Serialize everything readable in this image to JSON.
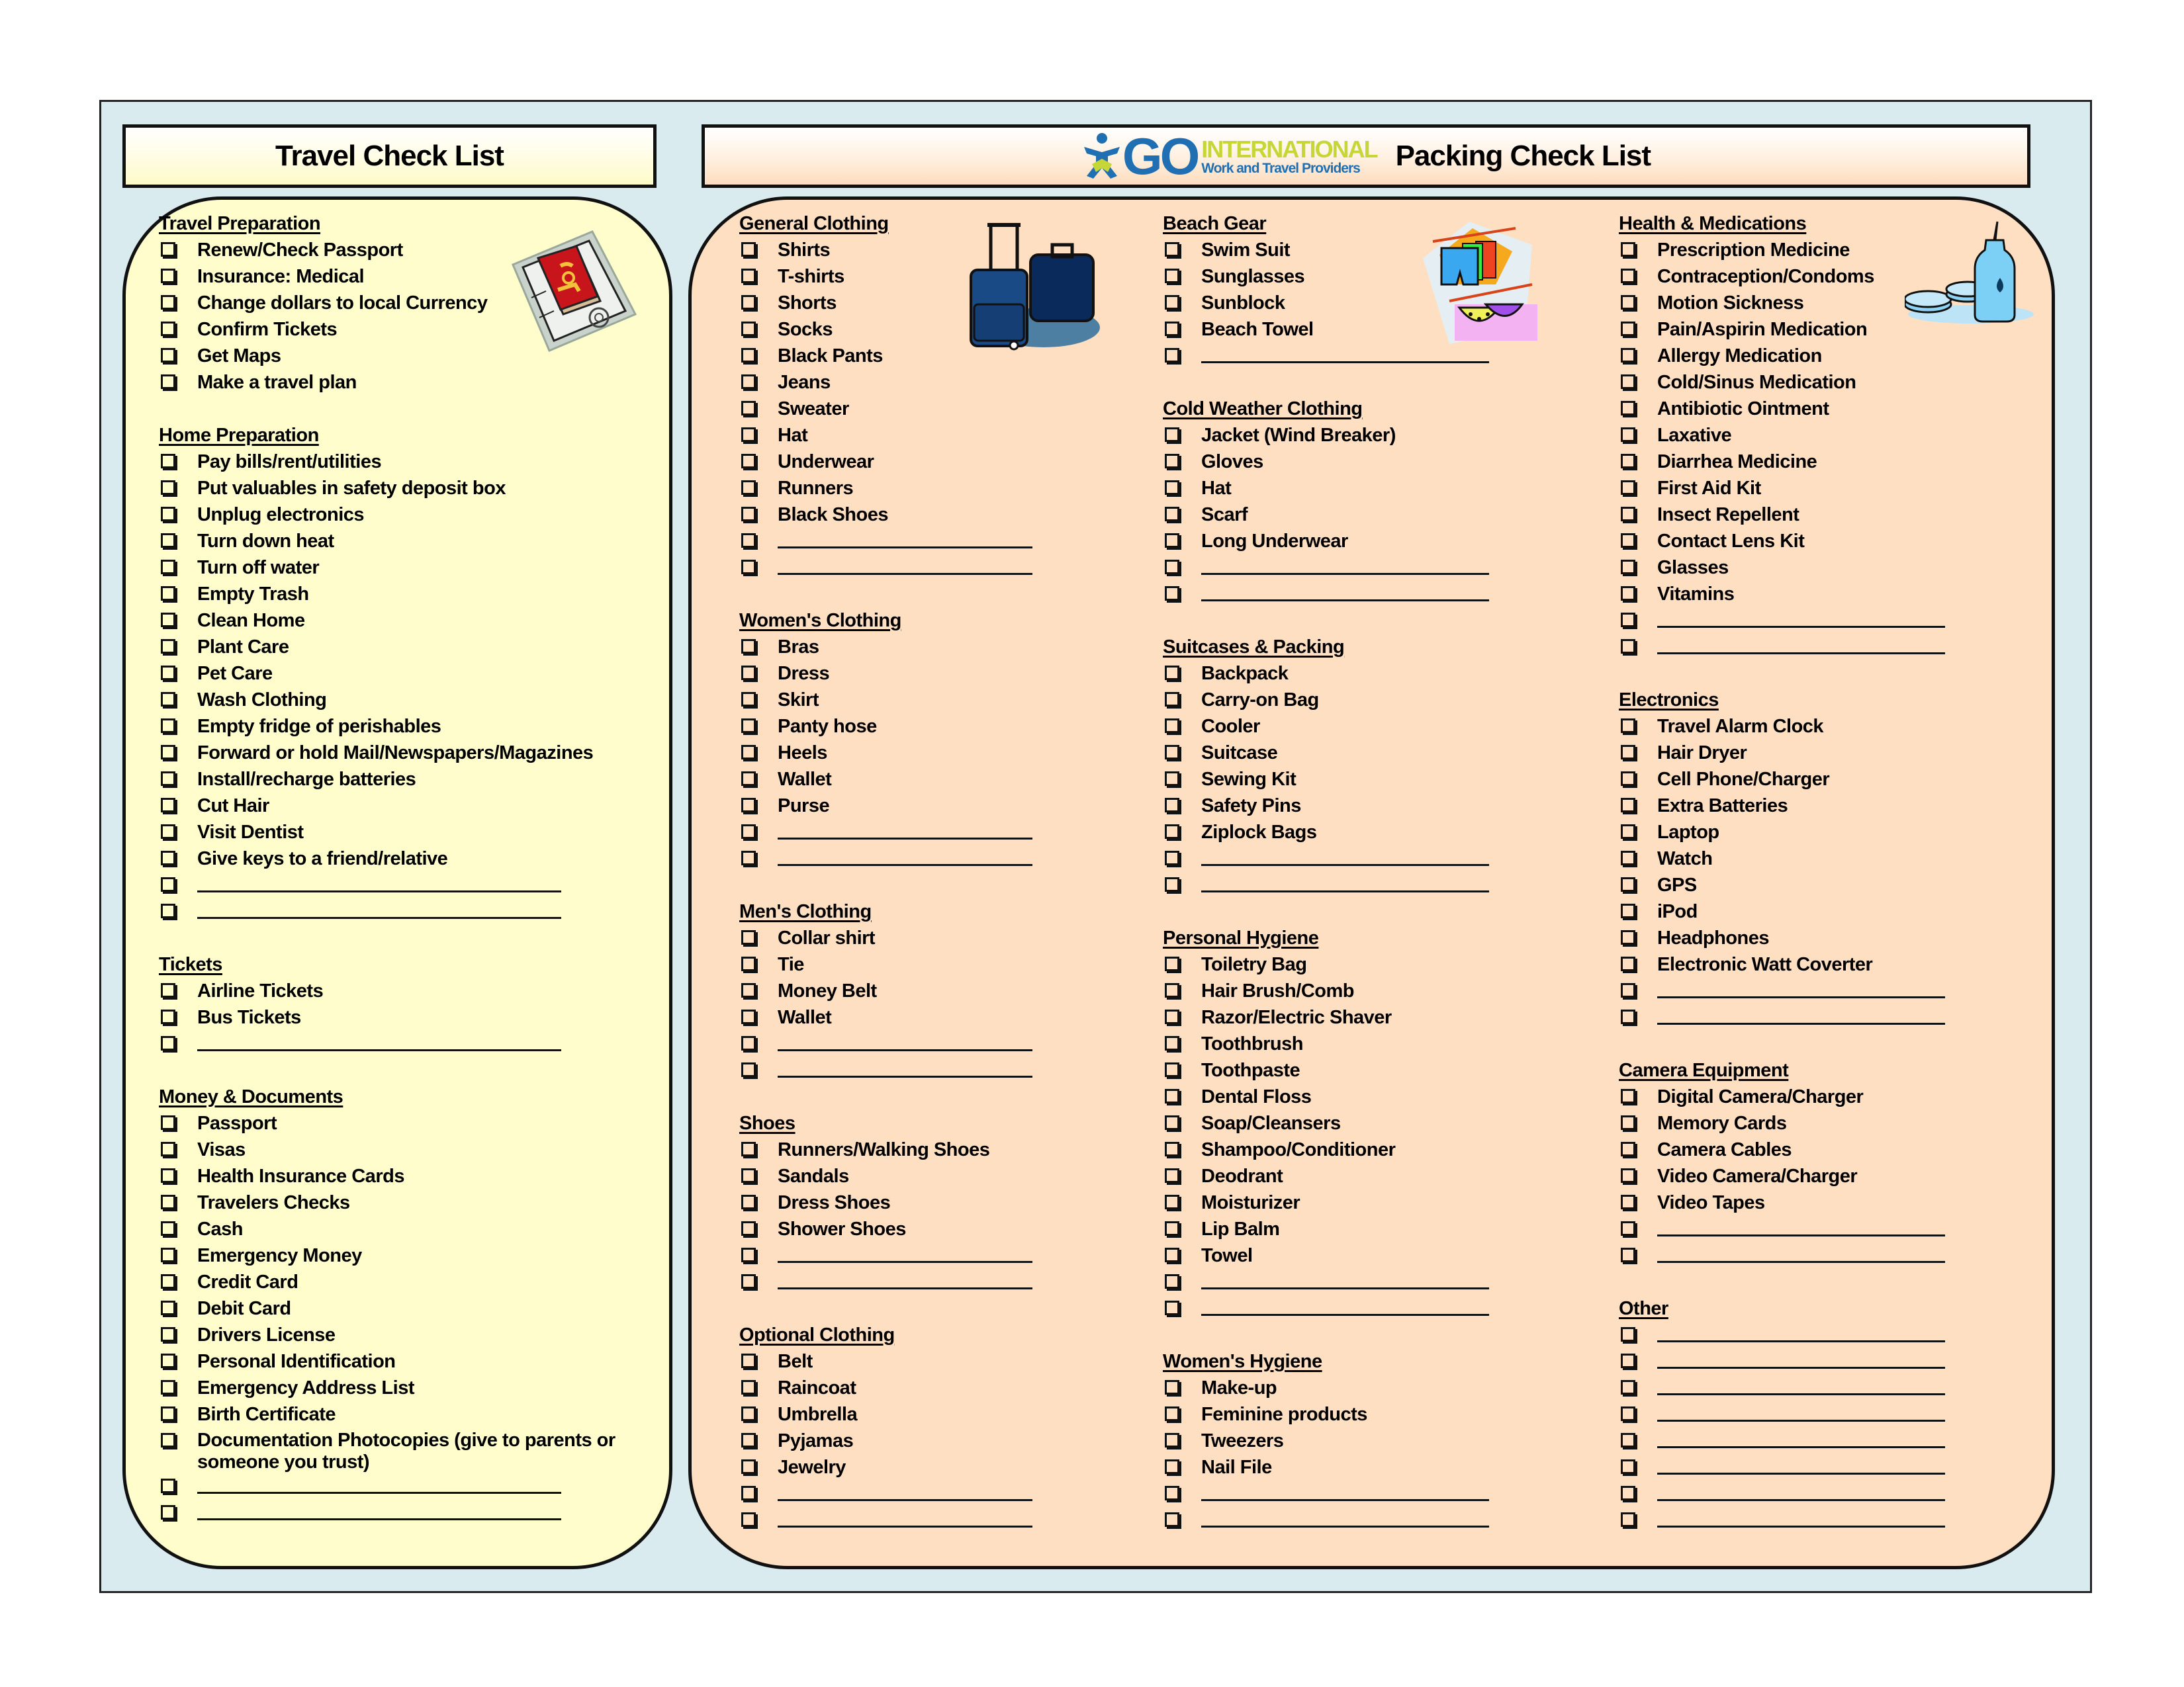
{
  "headers": {
    "left_title": "Travel Check List",
    "right_title": "Packing Check List",
    "logo": {
      "primary": "GO",
      "secondary": "INTERNATIONAL",
      "tagline": "Work and Travel Providers"
    }
  },
  "colors": {
    "frame_bg": "#DAEBEF",
    "left_panel_bg": "#FEFDCB",
    "right_panel_bg": "#FFDFC2",
    "logo_blue": "#1F6FB2",
    "logo_green": "#C6D637"
  },
  "columns": [
    {
      "sections": [
        {
          "title": "Travel Preparation",
          "items": [
            "Renew/Check Passport",
            "Insurance: Medical",
            "Change dollars to local Currency",
            "Confirm Tickets",
            "Get Maps",
            "Make a travel plan"
          ]
        },
        {
          "title": "Home Preparation",
          "items": [
            "Pay bills/rent/utilities",
            "Put valuables in safety deposit box",
            "Unplug electronics",
            "Turn down heat",
            "Turn off water",
            "Empty Trash",
            "Clean Home",
            "Plant Care",
            "Pet Care",
            "Wash Clothing",
            "Empty fridge of perishables",
            "Forward or hold Mail/Newspapers/Magazines",
            "Install/recharge batteries",
            "Cut Hair",
            "Visit Dentist",
            "Give keys to a friend/relative",
            "",
            ""
          ]
        },
        {
          "title": "Tickets",
          "items": [
            "Airline Tickets",
            "Bus Tickets",
            ""
          ]
        },
        {
          "title": "Money & Documents",
          "items": [
            "Passport",
            "Visas",
            "Health Insurance Cards",
            "Travelers Checks",
            "Cash",
            "Emergency Money",
            "Credit Card",
            "Debit Card",
            "Drivers License",
            "Personal Identification",
            "Emergency Address List",
            "Birth Certificate",
            "Documentation Photocopies (give to parents or someone you trust)",
            "",
            ""
          ]
        }
      ]
    },
    {
      "sections": [
        {
          "title": "General Clothing",
          "items": [
            "Shirts",
            "T-shirts",
            "Shorts",
            "Socks",
            "Black Pants",
            "Jeans",
            "Sweater",
            "Hat",
            "Underwear",
            "Runners",
            "Black Shoes",
            "",
            ""
          ]
        },
        {
          "title": "Women's Clothing",
          "items": [
            "Bras",
            "Dress",
            "Skirt",
            "Panty hose",
            "Heels",
            "Wallet",
            "Purse",
            "",
            ""
          ]
        },
        {
          "title": "Men's Clothing",
          "items": [
            "Collar shirt",
            "Tie",
            "Money Belt",
            "Wallet",
            "",
            ""
          ]
        },
        {
          "title": "Shoes",
          "items": [
            "Runners/Walking Shoes",
            "Sandals",
            "Dress Shoes",
            "Shower Shoes",
            "",
            ""
          ]
        },
        {
          "title": "Optional Clothing",
          "items": [
            "Belt",
            "Raincoat",
            "Umbrella",
            "Pyjamas",
            "Jewelry",
            "",
            ""
          ]
        }
      ]
    },
    {
      "sections": [
        {
          "title": "Beach Gear",
          "items": [
            "Swim Suit",
            "Sunglasses",
            "Sunblock",
            "Beach Towel",
            ""
          ]
        },
        {
          "title": "Cold Weather Clothing",
          "items": [
            "Jacket (Wind Breaker)",
            "Gloves",
            "Hat",
            "Scarf",
            "Long Underwear",
            "",
            ""
          ]
        },
        {
          "title": "Suitcases & Packing",
          "items": [
            "Backpack",
            "Carry-on Bag",
            "Cooler",
            "Suitcase",
            "Sewing Kit",
            "Safety Pins",
            "Ziplock Bags",
            "",
            ""
          ]
        },
        {
          "title": "Personal Hygiene",
          "items": [
            "Toiletry Bag",
            "Hair Brush/Comb",
            "Razor/Electric Shaver",
            "Toothbrush",
            "Toothpaste",
            "Dental Floss",
            "Soap/Cleansers",
            "Shampoo/Conditioner",
            "Deodrant",
            "Moisturizer",
            "Lip Balm",
            "Towel",
            "",
            ""
          ]
        },
        {
          "title": "Women's Hygiene",
          "items": [
            "Make-up",
            "Feminine products",
            "Tweezers",
            "Nail File",
            "",
            ""
          ]
        }
      ]
    },
    {
      "sections": [
        {
          "title": "Health & Medications",
          "items": [
            "Prescription Medicine",
            "Contraception/Condoms",
            "Motion Sickness",
            "Pain/Aspirin Medication",
            "Allergy Medication",
            "Cold/Sinus Medication",
            "Antibiotic Ointment",
            "Laxative",
            "Diarrhea Medicine",
            "First Aid Kit",
            "Insect Repellent",
            "Contact Lens Kit",
            "Glasses",
            "Vitamins",
            "",
            ""
          ]
        },
        {
          "title": "Electronics",
          "items": [
            "Travel Alarm Clock",
            "Hair Dryer",
            "Cell Phone/Charger",
            "Extra Batteries",
            "Laptop",
            "Watch",
            "GPS",
            "iPod",
            "Headphones",
            "Electronic Watt Coverter",
            "",
            ""
          ]
        },
        {
          "title": "Camera Equipment",
          "items": [
            "Digital Camera/Charger",
            "Memory Cards",
            "Camera Cables",
            "Video Camera/Charger",
            "Video Tapes",
            "",
            ""
          ]
        },
        {
          "title": "Other",
          "items": [
            "",
            "",
            "",
            "",
            "",
            "",
            "",
            ""
          ]
        }
      ]
    }
  ],
  "illustrations": [
    "passport-icon",
    "luggage-icon",
    "swimwear-icon",
    "medicine-bottle-icon"
  ]
}
